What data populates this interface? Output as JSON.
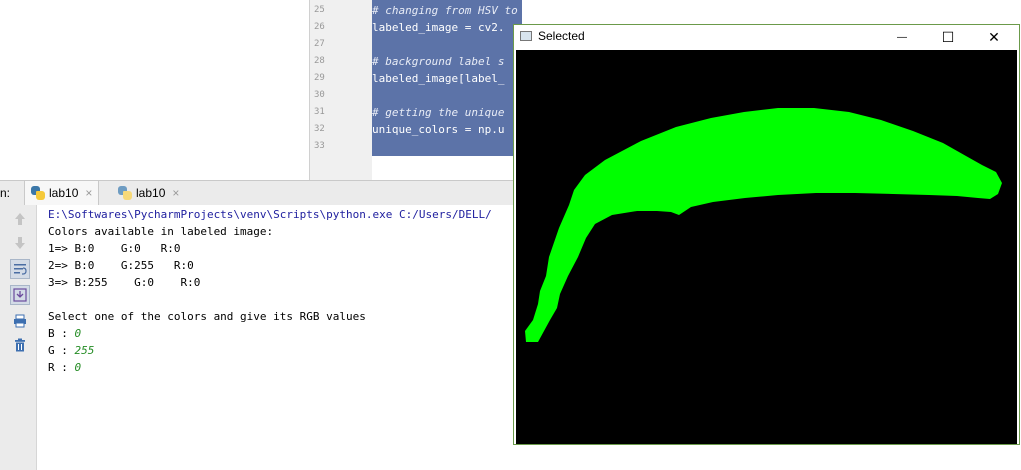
{
  "editor": {
    "line_numbers": [
      "25",
      "26",
      "27",
      "28",
      "29",
      "30",
      "31",
      "32",
      "33"
    ],
    "code_lines": [
      {
        "text": "# changing from HSV to RGB again to show",
        "comment": true
      },
      {
        "text": "labeled_image = cv2.",
        "comment": false
      },
      {
        "text": "",
        "comment": false
      },
      {
        "text": "# background label s",
        "comment": true
      },
      {
        "text": "labeled_image[label_",
        "comment": false
      },
      {
        "text": "",
        "comment": false
      },
      {
        "text": "# getting the unique",
        "comment": true
      },
      {
        "text": "unique_colors = np.u",
        "comment": false
      },
      {
        "text": "",
        "comment": false
      }
    ]
  },
  "run": {
    "prefix": "n:",
    "tabs": [
      {
        "label": "lab10",
        "close": "×"
      },
      {
        "label": "lab10",
        "close": "×"
      }
    ]
  },
  "console": {
    "lines": [
      "E:\\Softwares\\PycharmProjects\\venv\\Scripts\\python.exe C:/Users/DELL/",
      "Colors available in labeled image:",
      "1=> B:0    G:0   R:0",
      "2=> B:0    G:255   R:0",
      "3=> B:255    G:0    R:0",
      "",
      "Select one of the colors and give its RGB values"
    ],
    "prompts": [
      {
        "label": "B : ",
        "value": "0"
      },
      {
        "label": "G : ",
        "value": "255"
      },
      {
        "label": "R : ",
        "value": "0"
      }
    ]
  },
  "cv_window": {
    "title": "Selected",
    "minimize": "—",
    "maximize": "☐",
    "close": "✕",
    "shape_color": "#00ff00",
    "background_color": "#000000"
  },
  "colors": {
    "selection_blue": "#5c73a8",
    "comment_text": "#e8ecf6",
    "console_path": "#1d1d9e",
    "console_input": "#248c24"
  }
}
